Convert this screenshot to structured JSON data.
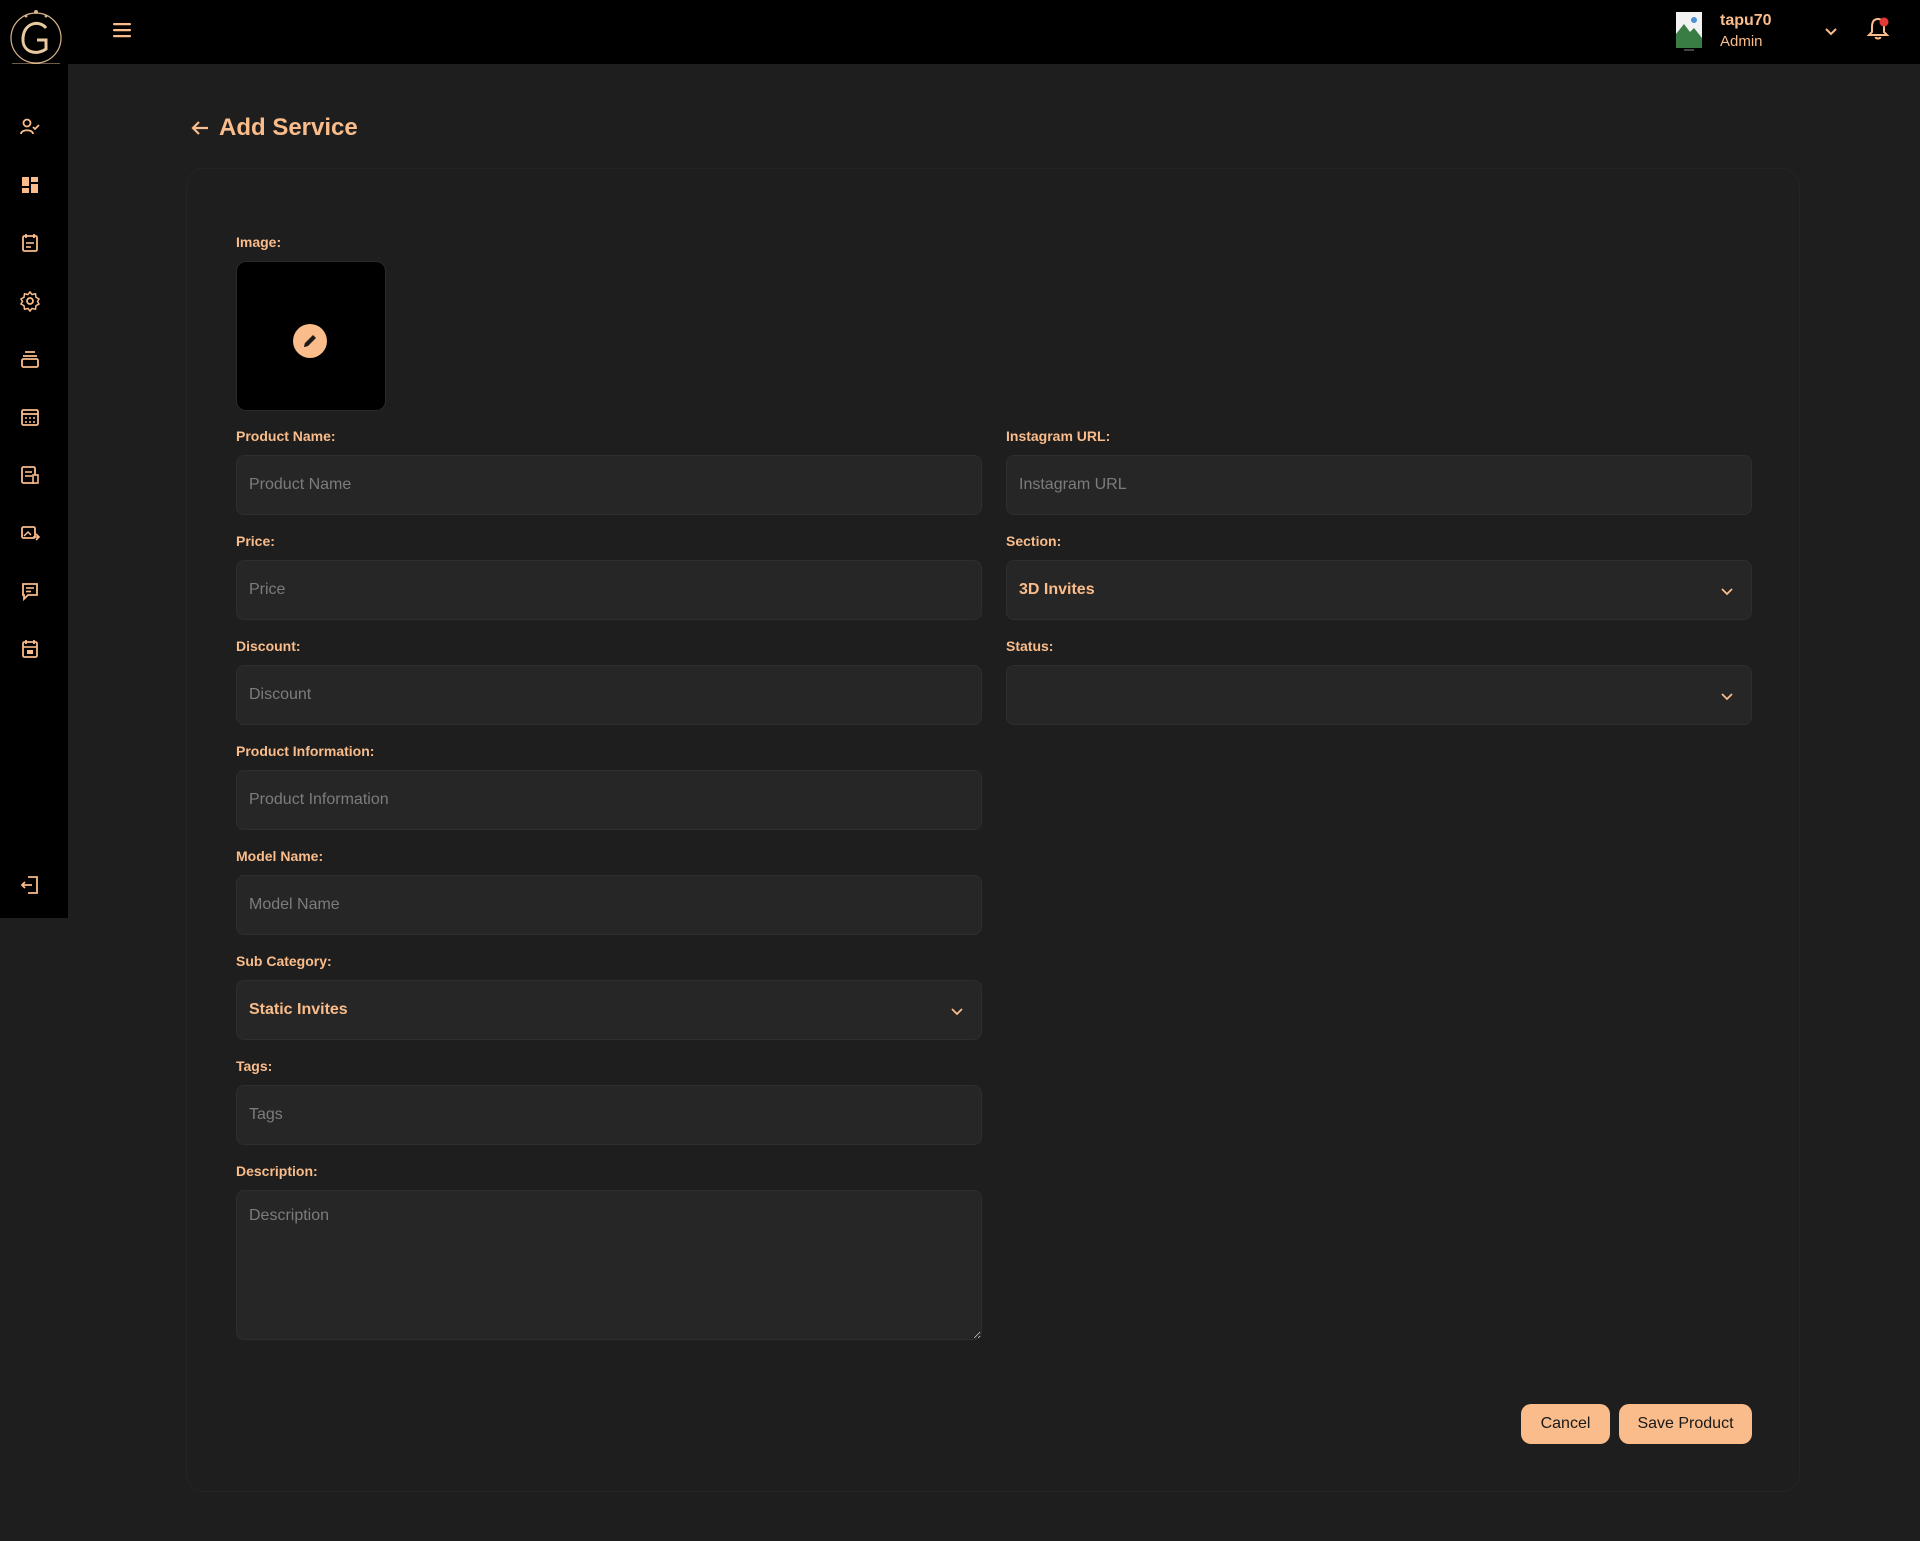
{
  "user": {
    "name": "tapu70",
    "role": "Admin"
  },
  "page": {
    "title": "Add Service"
  },
  "form": {
    "image_label": "Image:",
    "product_name": {
      "label": "Product Name:",
      "placeholder": "Product Name",
      "value": ""
    },
    "instagram_url": {
      "label": "Instagram URL:",
      "placeholder": "Instagram URL",
      "value": ""
    },
    "price": {
      "label": "Price:",
      "placeholder": "Price",
      "value": ""
    },
    "section": {
      "label": "Section:",
      "selected": "3D Invites"
    },
    "discount": {
      "label": "Discount:",
      "placeholder": "Discount",
      "value": ""
    },
    "status": {
      "label": "Status:",
      "selected": ""
    },
    "product_information": {
      "label": "Product Information:",
      "placeholder": "Product Information",
      "value": ""
    },
    "model_name": {
      "label": "Model Name:",
      "placeholder": "Model Name",
      "value": ""
    },
    "sub_category": {
      "label": "Sub Category:",
      "selected": "Static Invites"
    },
    "tags": {
      "label": "Tags:",
      "placeholder": "Tags",
      "value": ""
    },
    "description": {
      "label": "Description:",
      "placeholder": "Description",
      "value": ""
    }
  },
  "actions": {
    "cancel": "Cancel",
    "save": "Save Product"
  },
  "sidebar": {
    "icons": [
      "user-check-icon",
      "dashboard-icon",
      "calendar-note-icon",
      "settings-icon",
      "layers-icon",
      "calendar-icon",
      "document-list-icon",
      "image-export-icon",
      "message-icon",
      "calendar-check-icon",
      "logout-icon"
    ]
  },
  "colors": {
    "accent": "#f9bc8a",
    "background": "#1e1e1e",
    "bar": "#000000",
    "field": "#262626",
    "badge": "#e53935"
  }
}
